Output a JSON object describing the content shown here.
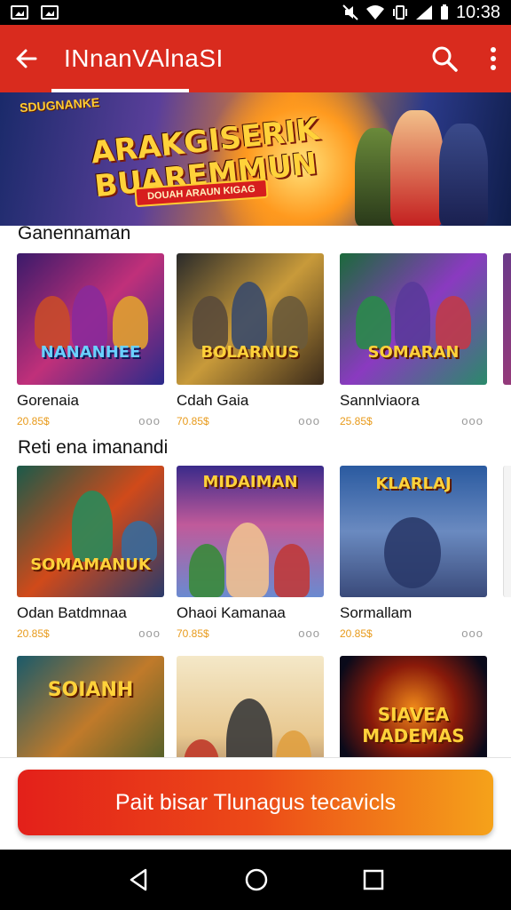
{
  "status_bar": {
    "time": "10:38"
  },
  "app_bar": {
    "title": "INnanVAlnaSI"
  },
  "banner": {
    "logo": "SDUGNANKE",
    "title_line1": "ARAKGISERIK",
    "title_line2": "BUAREMMUN",
    "ribbon": "DOUAH ARAUN KIGAG"
  },
  "sections": [
    {
      "title": "Ganennaman",
      "cards": [
        {
          "title": "Gorenaia",
          "art_label": "NANANHEE",
          "price": "20.85$",
          "more": "ooo"
        },
        {
          "title": "Cdah Gaia",
          "art_label": "BOLARNUS",
          "price": "70.85$",
          "more": "ooo"
        },
        {
          "title": "Sannlviaora",
          "art_label": "SOMARAN",
          "price": "25.85$",
          "more": "ooo"
        }
      ]
    },
    {
      "title": "Reti ena imanandi",
      "cards": [
        {
          "title": "Odan Batdmnaa",
          "art_label": "SOMAMANUK",
          "price": "20.85$",
          "more": "ooo"
        },
        {
          "title": "Ohaoi Kamanaa",
          "art_label": "MIDAIMAN",
          "price": "70.85$",
          "more": "ooo"
        },
        {
          "title": "Sormallam",
          "art_label": "KLARLAJ",
          "price": "20.85$",
          "more": "ooo"
        }
      ]
    },
    {
      "title": "",
      "cards": [
        {
          "title": "",
          "art_label": "SOIANH",
          "price": "",
          "more": ""
        },
        {
          "title": "",
          "art_label": "",
          "price": "",
          "more": ""
        },
        {
          "title": "",
          "art_label": "SIAVEA MADEMAS",
          "price": "",
          "more": ""
        }
      ]
    }
  ],
  "cta": {
    "label": "Pait bisar Tlunagus tecavicls"
  },
  "colors": {
    "primary": "#d92b1e",
    "cta_start": "#e3201a",
    "cta_end": "#f5a21a",
    "price": "#e89a1a"
  }
}
